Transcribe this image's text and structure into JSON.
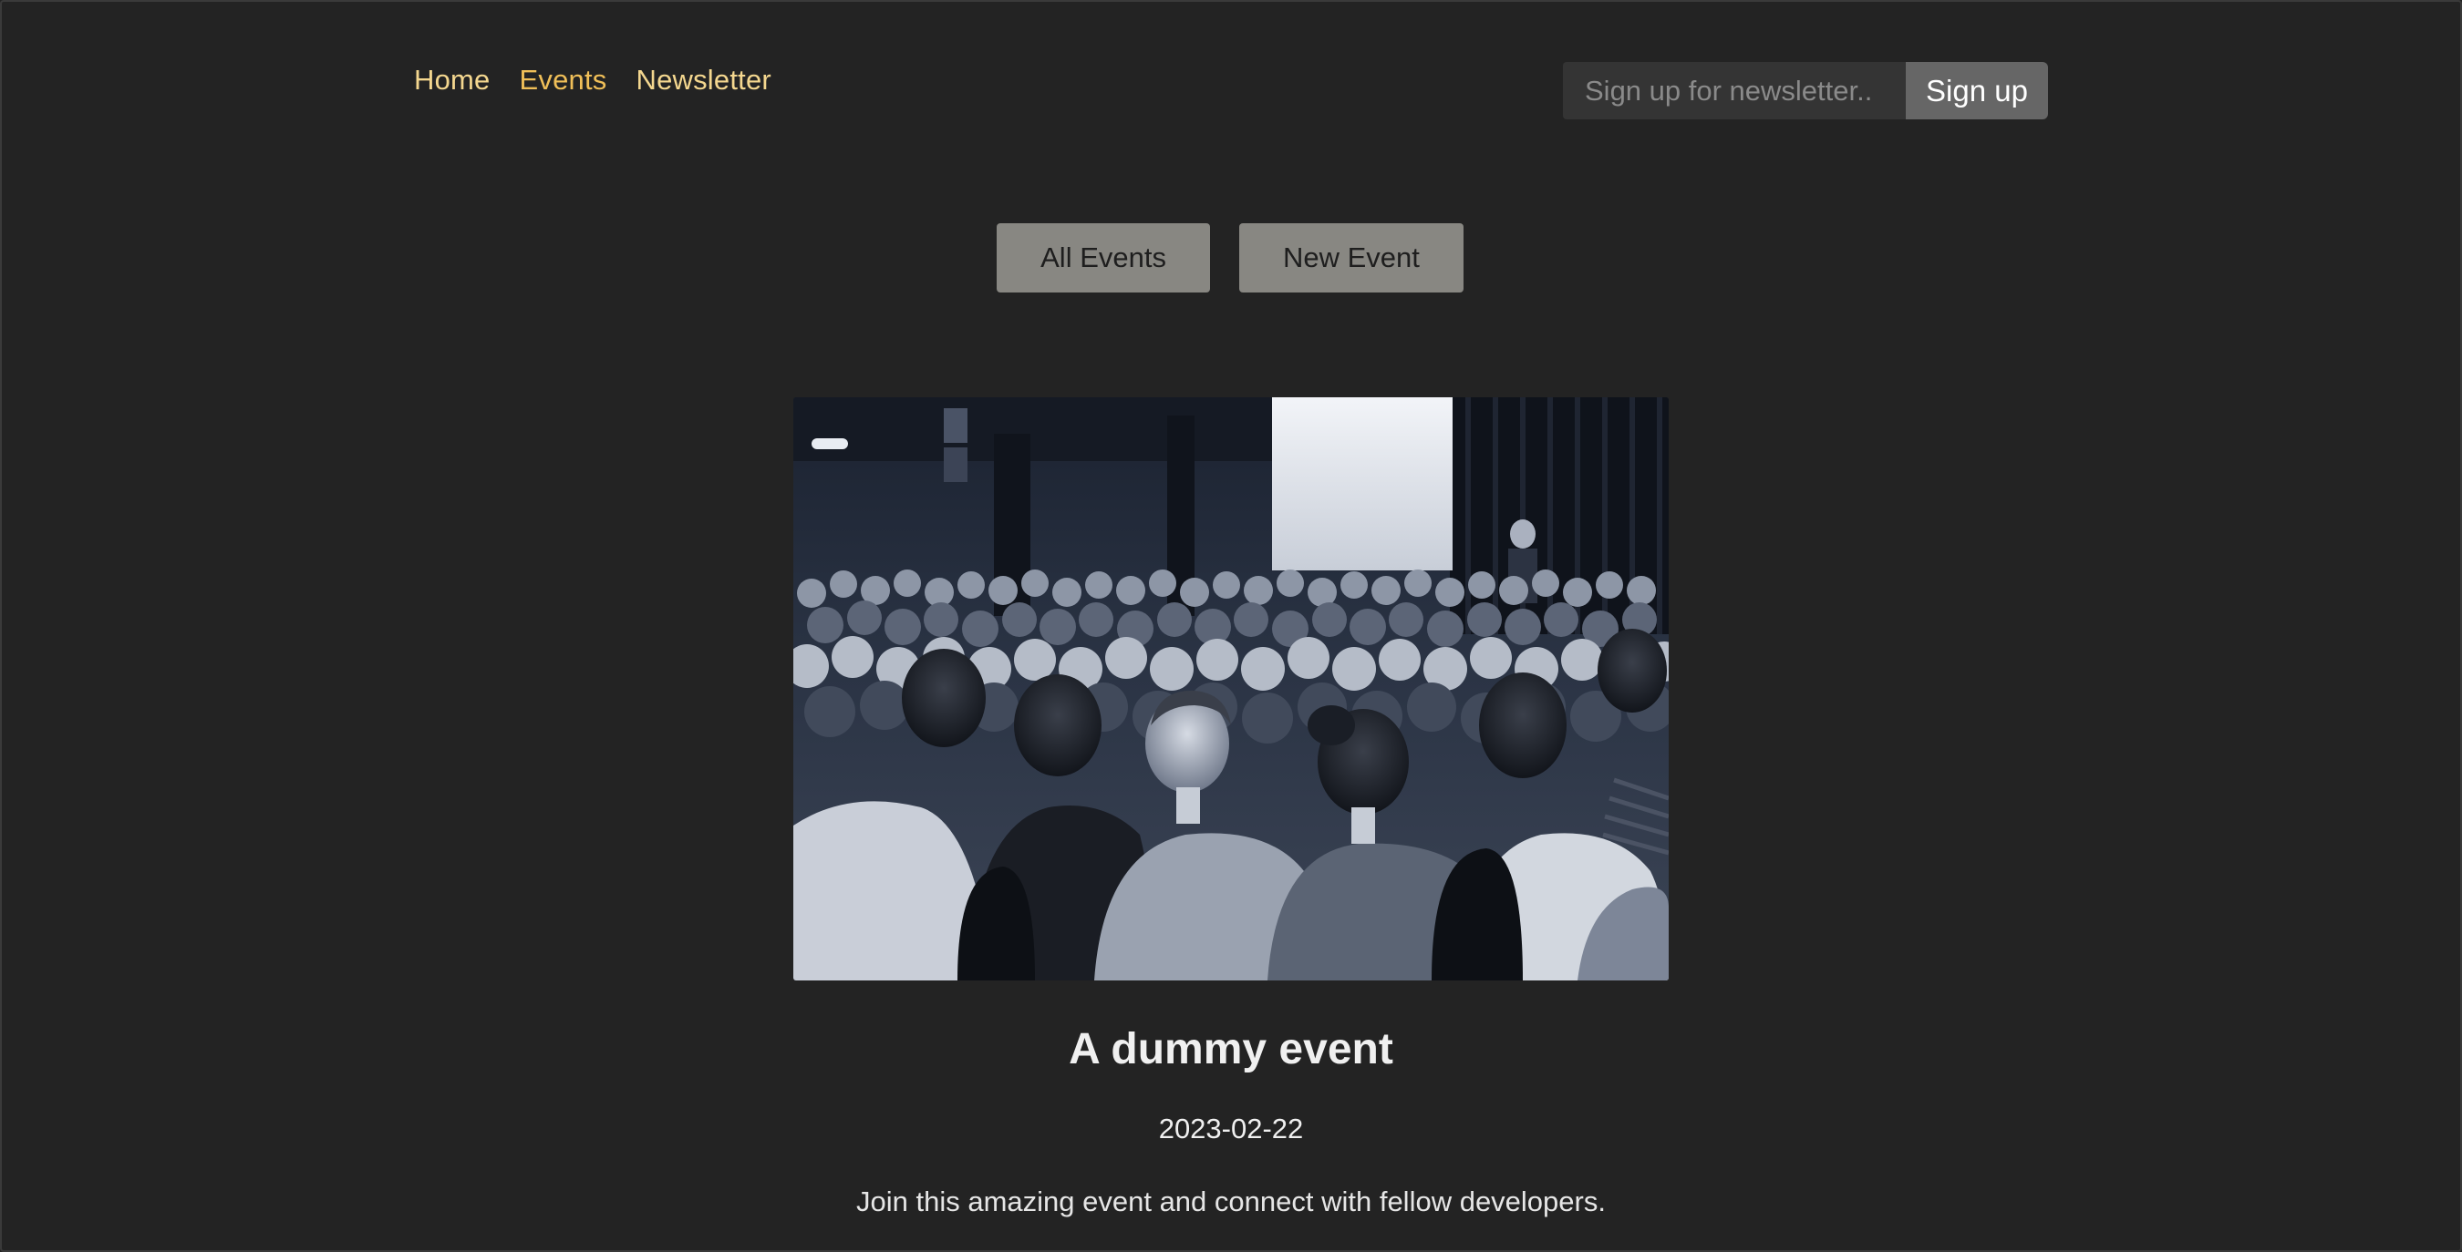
{
  "nav": {
    "items": [
      {
        "label": "Home",
        "active": false
      },
      {
        "label": "Events",
        "active": true
      },
      {
        "label": "Newsletter",
        "active": false
      }
    ]
  },
  "newsletter": {
    "placeholder": "Sign up for newsletter..",
    "button_label": "Sign up"
  },
  "actions": {
    "all_events_label": "All Events",
    "new_event_label": "New Event"
  },
  "event": {
    "title": "A dummy event",
    "date": "2023-02-22",
    "description": "Join this amazing event and connect with fellow developers.",
    "image_alt": "conference-audience-photo"
  },
  "colors": {
    "background": "#232323",
    "nav_link": "#f4d78f",
    "nav_link_active": "#f0bf58",
    "action_button": "#888782",
    "signup_button": "#666666",
    "input_background": "#343434"
  }
}
